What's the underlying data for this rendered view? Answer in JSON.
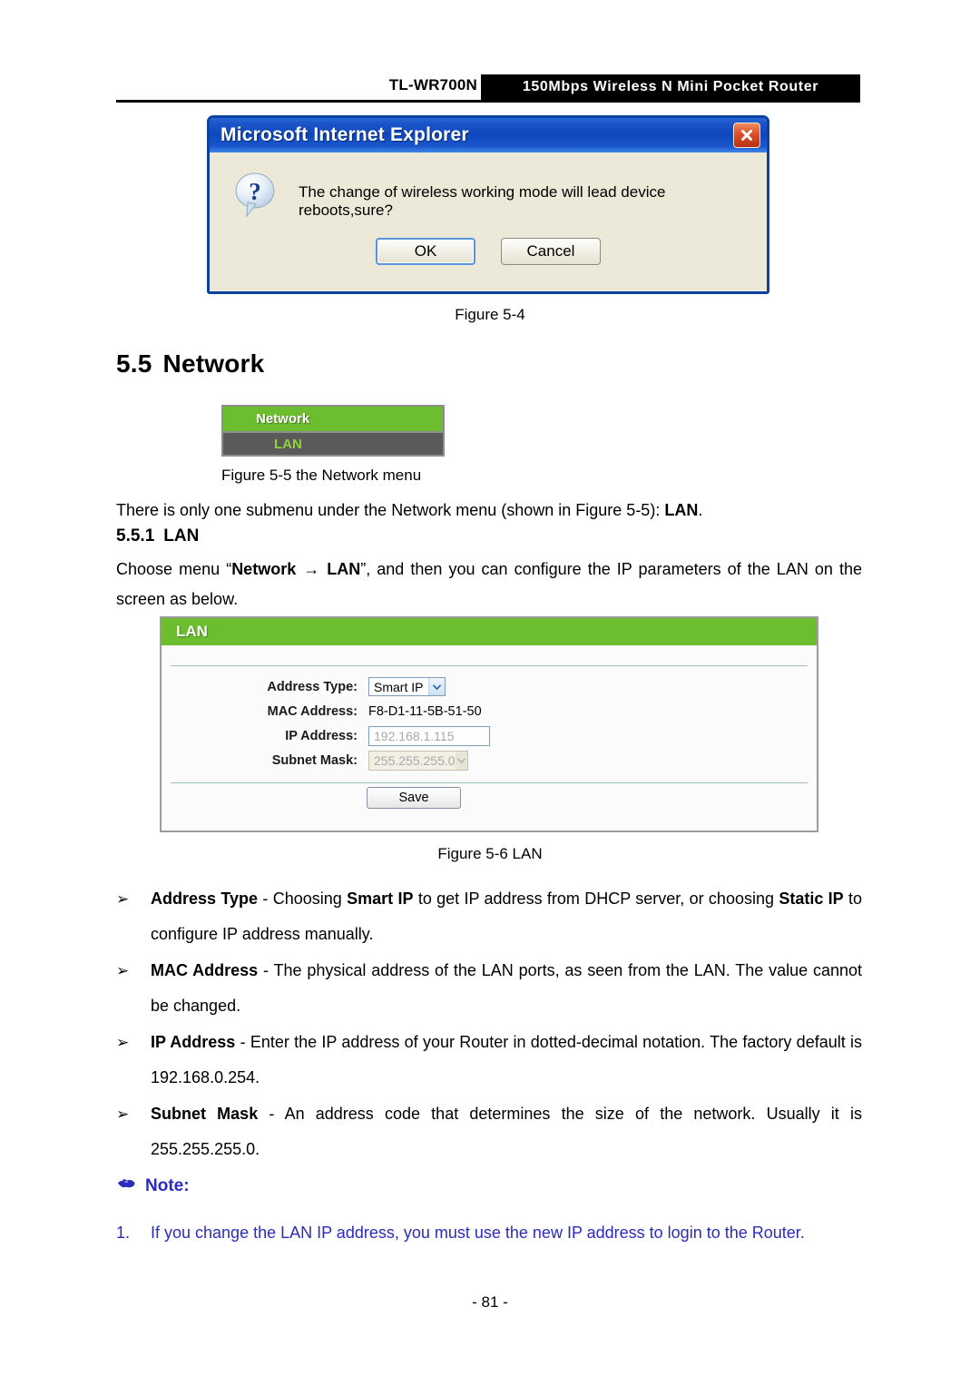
{
  "header": {
    "model": "TL-WR700N",
    "product": "150Mbps Wireless N Mini Pocket Router"
  },
  "dialog": {
    "title": "Microsoft Internet Explorer",
    "message": "The change of wireless working mode will lead device reboots,sure?",
    "ok_label": "OK",
    "cancel_label": "Cancel",
    "close_icon": "close-icon",
    "question_icon": "question-icon"
  },
  "captions": {
    "fig_5_4": "Figure 5-4",
    "fig_5_5": "Figure 5-5    the Network menu",
    "fig_5_6": "Figure 5-6   LAN"
  },
  "headings": {
    "section_num": "5.5",
    "section_title": "Network",
    "sub_num": "5.5.1",
    "sub_title": "LAN"
  },
  "network_menu": {
    "header": "Network",
    "items": [
      "LAN"
    ]
  },
  "paragraphs": {
    "intro_p1": "There is only one submenu under the Network menu (shown in ",
    "intro_fig": "Figure 5-5",
    "intro_p2": "): ",
    "intro_lan": "LAN",
    "intro_p3": ".",
    "choose_p1": "Choose menu “",
    "choose_network": "Network",
    "choose_arrow": "→",
    "choose_lan": "LAN",
    "choose_p2": "”, and then you can configure the IP parameters of the LAN on the screen as below."
  },
  "lan_panel": {
    "title": "LAN",
    "fields": [
      {
        "label": "Address Type:",
        "type": "select",
        "value": "Smart IP"
      },
      {
        "label": "MAC Address:",
        "type": "static",
        "value": "F8-D1-11-5B-51-50"
      },
      {
        "label": "IP Address:",
        "type": "text",
        "value": "192.168.1.115"
      },
      {
        "label": "Subnet Mask:",
        "type": "select-disabled",
        "value": "255.255.255.0"
      }
    ],
    "save_label": "Save"
  },
  "bullets": [
    {
      "marker": "➢",
      "term": "Address Type",
      "dash": " - ",
      "body_1": "Choosing ",
      "strong_1": "Smart IP",
      "body_2": " to get IP address from DHCP server, or choosing ",
      "strong_2": "Static IP",
      "body_3": " to configure IP address manually."
    },
    {
      "marker": "➢",
      "term": "MAC Address",
      "dash": " - ",
      "body_1": "The physical address of the LAN ports, as seen from the LAN. The value cannot be changed."
    },
    {
      "marker": "➢",
      "term": "IP Address",
      "dash": " - ",
      "body_1": "Enter the IP address of your Router in dotted-decimal notation. The factory default is 192.168.0.254."
    },
    {
      "marker": "➢",
      "term": "Subnet Mask",
      "dash": " - ",
      "body_1": "An address code that determines the size of the network. Usually it is 255.255.255.0."
    }
  ],
  "note": {
    "icon": "pointing-hand-icon",
    "label": "Note:",
    "number": "1.",
    "text": "If you change the LAN IP address, you must use the new IP address to login to the Router."
  },
  "footer": {
    "page": "- 81 -"
  },
  "colors": {
    "brand_green": "#6cbe2e",
    "menu_item_green": "#8fd43a",
    "menu_gray": "#5a5a5a",
    "note_blue": "#2b2bbd",
    "ie_title_blue": "#0e47be",
    "ie_body_beige": "#ece9d8"
  }
}
